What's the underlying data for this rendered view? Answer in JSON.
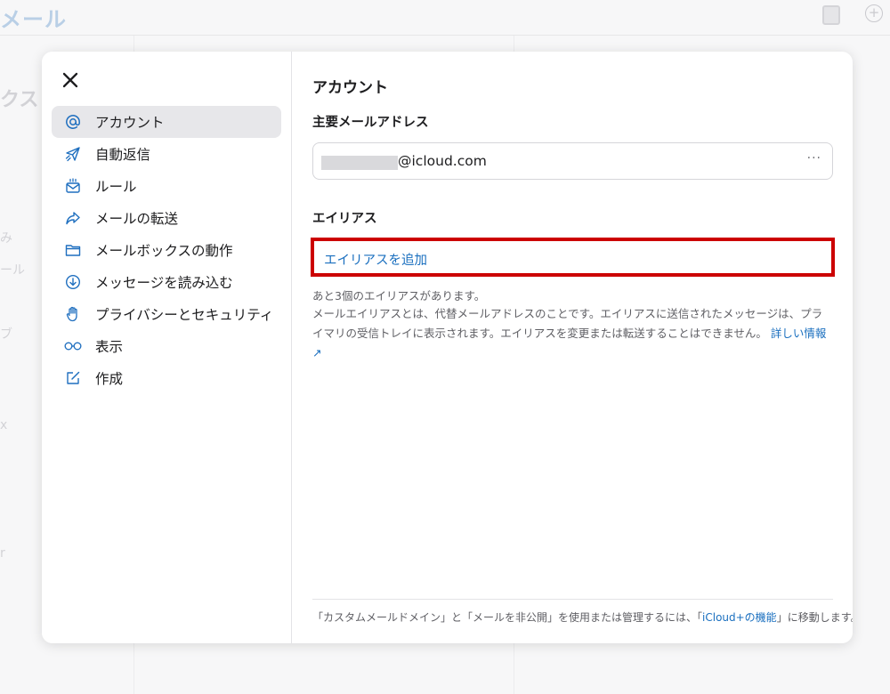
{
  "background": {
    "app_title": "メール",
    "fragments": [
      "クス",
      "み",
      "ール",
      "ブ",
      "x",
      "r"
    ]
  },
  "modal": {
    "sidebar": {
      "items": [
        {
          "label": "アカウント",
          "icon": "at-icon",
          "active": true
        },
        {
          "label": "自動返信",
          "icon": "plane-icon",
          "active": false
        },
        {
          "label": "ルール",
          "icon": "envelope-rule-icon",
          "active": false
        },
        {
          "label": "メールの転送",
          "icon": "forward-arrow-icon",
          "active": false
        },
        {
          "label": "メールボックスの動作",
          "icon": "folder-icon",
          "active": false
        },
        {
          "label": "メッセージを読み込む",
          "icon": "download-circle-icon",
          "active": false
        },
        {
          "label": "プライバシーとセキュリティ",
          "icon": "hand-icon",
          "active": false
        },
        {
          "label": "表示",
          "icon": "glasses-icon",
          "active": false
        },
        {
          "label": "作成",
          "icon": "compose-icon",
          "active": false
        }
      ]
    },
    "content": {
      "title": "アカウント",
      "primary_label": "主要メールアドレス",
      "email_suffix": "@icloud.com",
      "more_label": "···",
      "alias_label": "エイリアス",
      "add_alias_label": "エイリアスを追加",
      "alias_count_note": "あと3個のエイリアスがあります。",
      "alias_description": "メールエイリアスとは、代替メールアドレスのことです。エイリアスに送信されたメッセージは、プライマリの受信トレイに表示されます。エイリアスを変更または転送することはできません。",
      "learn_more_label": "詳しい情報 ↗",
      "footer_pre": "「カスタムメールドメイン」と「メールを非公開」を使用または管理するには、「",
      "footer_link": "iCloud+の機能",
      "footer_post": "」に移動します。"
    }
  },
  "colors": {
    "accent": "#1a6fbf",
    "highlight_border": "#cc0000",
    "active_item_bg": "#e7e7ea"
  }
}
